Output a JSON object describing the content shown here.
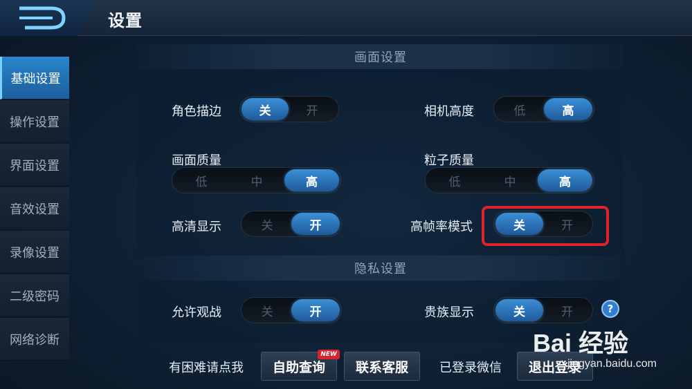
{
  "header": {
    "title": "设置",
    "back_icon": "back-arrow-icon"
  },
  "sidebar": {
    "items": [
      {
        "label": "基础设置",
        "active": true
      },
      {
        "label": "操作设置",
        "active": false
      },
      {
        "label": "界面设置",
        "active": false
      },
      {
        "label": "音效设置",
        "active": false
      },
      {
        "label": "录像设置",
        "active": false
      },
      {
        "label": "二级密码",
        "active": false
      },
      {
        "label": "网络诊断",
        "active": false
      }
    ]
  },
  "display_section": {
    "title": "画面设置",
    "settings": [
      {
        "label": "角色描边",
        "options": [
          "关",
          "开"
        ],
        "selected": "关"
      },
      {
        "label": "相机高度",
        "options": [
          "低",
          "高"
        ],
        "selected": "高"
      },
      {
        "label": "画面质量",
        "options": [
          "低",
          "中",
          "高"
        ],
        "selected": "高"
      },
      {
        "label": "粒子质量",
        "options": [
          "低",
          "中",
          "高"
        ],
        "selected": "高"
      },
      {
        "label": "高清显示",
        "options": [
          "关",
          "开"
        ],
        "selected": "开"
      },
      {
        "label": "高帧率模式",
        "options": [
          "关",
          "开"
        ],
        "selected": "关"
      }
    ]
  },
  "privacy_section": {
    "title": "隐私设置",
    "settings": [
      {
        "label": "允许观战",
        "options": [
          "关",
          "开"
        ],
        "selected": "开"
      },
      {
        "label": "贵族显示",
        "options": [
          "关",
          "开"
        ],
        "selected": "关"
      }
    ],
    "help_icon": "?"
  },
  "footer": {
    "help_text": "有困难请点我",
    "self_help_button": "自助查询",
    "new_badge": "NEW",
    "contact_button": "联系客服",
    "wechat_status": "已登录微信",
    "logout_button": "退出登录"
  },
  "watermark": {
    "brand": "Bai  经验",
    "url": "jingyan.baidu.com"
  },
  "colors": {
    "accent": "#2f86d0",
    "highlight_box": "#e0212e"
  }
}
